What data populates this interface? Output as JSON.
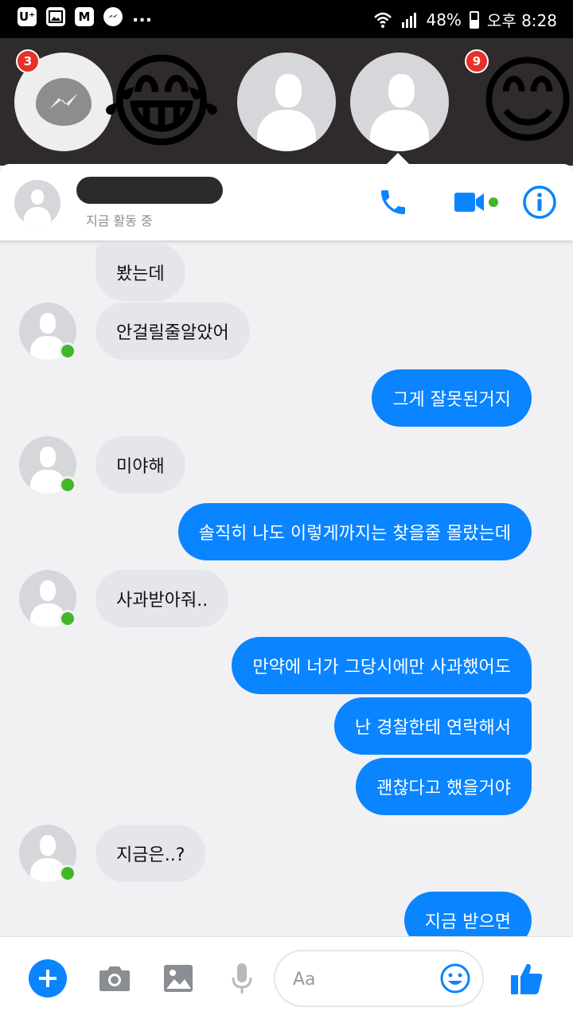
{
  "status_bar": {
    "left_icons": [
      "U⁺",
      "image-icon",
      "M",
      "messenger-icon"
    ],
    "more": "...",
    "battery": "48%",
    "time": "오후 8:28"
  },
  "chat_heads": [
    {
      "type": "messenger",
      "badge": "3"
    },
    {
      "type": "emoji",
      "emoji": "😂"
    },
    {
      "type": "profile"
    },
    {
      "type": "profile"
    },
    {
      "type": "emoji",
      "emoji": "😊",
      "badge": "9"
    }
  ],
  "header": {
    "presence": "지금 활동 중",
    "accent": "#0a84ff"
  },
  "messages": [
    {
      "dir": "in",
      "text": "봤는데"
    },
    {
      "dir": "in",
      "text": "안걸릴줄알았어"
    },
    {
      "dir": "out",
      "text": "그게 잘못된거지"
    },
    {
      "dir": "in",
      "text": "미야해"
    },
    {
      "dir": "out",
      "text": "솔직히 나도 이렇게까지는 찾을줄 몰랐는데"
    },
    {
      "dir": "in",
      "text": "사과받아줘.."
    },
    {
      "dir": "out",
      "text": "만약에 너가 그당시에만 사과했어도"
    },
    {
      "dir": "out",
      "text": "난 경찰한테 연락해서"
    },
    {
      "dir": "out",
      "text": "괜찮다고 했을거야"
    },
    {
      "dir": "in",
      "text": "지금은..?"
    },
    {
      "dir": "out",
      "text": "지금 받으면"
    }
  ],
  "composer": {
    "placeholder": "Aa"
  }
}
